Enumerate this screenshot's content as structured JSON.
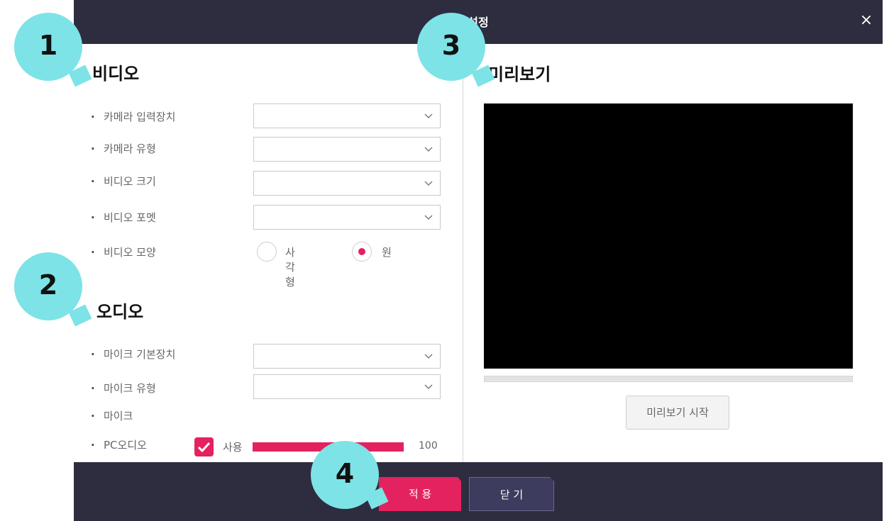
{
  "window": {
    "title": "설정",
    "close_glyph": "×"
  },
  "video": {
    "title": "비디오",
    "rows": [
      {
        "label": "카메라 입력장치"
      },
      {
        "label": "카메라 유형"
      },
      {
        "label": "비디오 크기"
      },
      {
        "label": "비디오 포멧"
      }
    ],
    "shape": {
      "label": "비디오 모양",
      "options": [
        "사각형",
        "원"
      ],
      "selected": "원"
    }
  },
  "audio": {
    "title": "오디오",
    "rows": [
      {
        "label": "마이크 기본장치"
      },
      {
        "label": "마이크 유형"
      }
    ],
    "mic_label": "마이크",
    "pc_audio": {
      "label": "PC오디오",
      "checkbox_label": "사용",
      "checked": true,
      "volume": 100
    }
  },
  "preview": {
    "title": "미리보기",
    "start_button": "미리보기 시작"
  },
  "footer": {
    "apply": "적 용",
    "close": "닫 기"
  },
  "callouts": [
    "1",
    "2",
    "3",
    "4"
  ],
  "colors": {
    "accent": "#e3225f",
    "titlebar": "#2d2d3f",
    "callout": "#7de3e7"
  }
}
